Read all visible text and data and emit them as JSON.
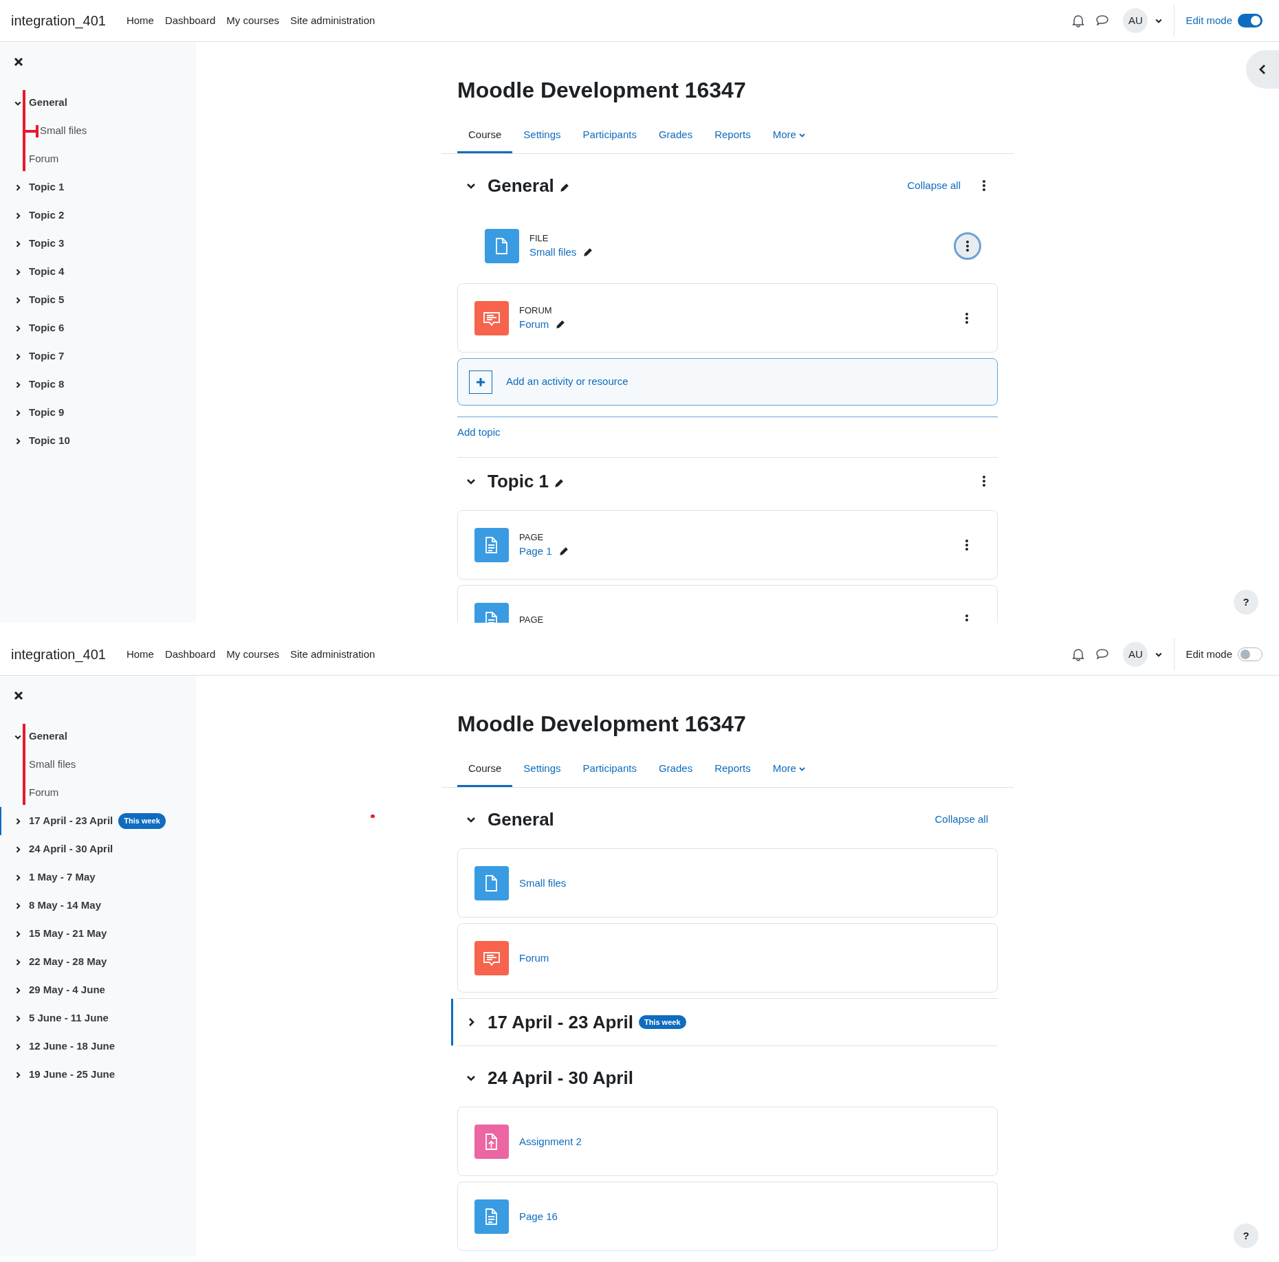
{
  "panels": [
    {
      "site_name": "integration_401",
      "nav": [
        "Home",
        "Dashboard",
        "My courses",
        "Site administration"
      ],
      "avatar": "AU",
      "edit_mode_label": "Edit mode",
      "edit_mode": true,
      "right_drawer_button": true,
      "annotation_dot": false,
      "help_label": "?",
      "sidebar": {
        "sections": [
          {
            "title": "General",
            "expanded": true,
            "annotated": true,
            "children": [
              {
                "title": "Small files",
                "annotated": true
              },
              {
                "title": "Forum"
              }
            ]
          },
          {
            "title": "Topic 1",
            "expanded": false
          },
          {
            "title": "Topic 2",
            "expanded": false
          },
          {
            "title": "Topic 3",
            "expanded": false
          },
          {
            "title": "Topic 4",
            "expanded": false
          },
          {
            "title": "Topic 5",
            "expanded": false
          },
          {
            "title": "Topic 6",
            "expanded": false
          },
          {
            "title": "Topic 7",
            "expanded": false
          },
          {
            "title": "Topic 8",
            "expanded": false
          },
          {
            "title": "Topic 9",
            "expanded": false
          },
          {
            "title": "Topic 10",
            "expanded": false
          }
        ]
      },
      "course_title": "Moodle Development 16347",
      "tabs": [
        {
          "label": "Course",
          "selected": true,
          "dropdown": false
        },
        {
          "label": "Settings",
          "selected": false,
          "dropdown": false
        },
        {
          "label": "Participants",
          "selected": false,
          "dropdown": false
        },
        {
          "label": "Grades",
          "selected": false,
          "dropdown": false
        },
        {
          "label": "Reports",
          "selected": false,
          "dropdown": false
        },
        {
          "label": "More",
          "selected": false,
          "dropdown": true
        }
      ],
      "sections": [
        {
          "title": "General",
          "expanded": true,
          "collapse_all": "Collapse all",
          "activities": [
            {
              "kind": "file",
              "type_label": "FILE",
              "name": "Small files",
              "boxed": false,
              "menu_focused": true
            },
            {
              "kind": "forum",
              "type_label": "FORUM",
              "name": "Forum",
              "boxed": true,
              "menu_focused": false
            }
          ],
          "add_activity": "Add an activity or resource",
          "add_topic": "Add topic"
        },
        {
          "title": "Topic 1",
          "expanded": true,
          "activities": [
            {
              "kind": "page",
              "type_label": "PAGE",
              "name": "Page 1",
              "boxed": true,
              "menu_focused": false
            },
            {
              "kind": "page",
              "type_label": "PAGE",
              "boxed": true,
              "menu_focused": false
            }
          ]
        }
      ]
    },
    {
      "site_name": "integration_401",
      "nav": [
        "Home",
        "Dashboard",
        "My courses",
        "Site administration"
      ],
      "avatar": "AU",
      "edit_mode_label": "Edit mode",
      "edit_mode": false,
      "right_drawer_button": false,
      "annotation_dot": true,
      "help_label": "?",
      "sidebar": {
        "sections": [
          {
            "title": "General",
            "expanded": true,
            "annotated": true,
            "children": [
              {
                "title": "Small files"
              },
              {
                "title": "Forum"
              }
            ]
          },
          {
            "title": "17 April - 23 April",
            "expanded": false,
            "current": true,
            "badge": "This week"
          },
          {
            "title": "24 April - 30 April",
            "expanded": false
          },
          {
            "title": "1 May - 7 May",
            "expanded": false
          },
          {
            "title": "8 May - 14 May",
            "expanded": false
          },
          {
            "title": "15 May - 21 May",
            "expanded": false
          },
          {
            "title": "22 May - 28 May",
            "expanded": false
          },
          {
            "title": "29 May - 4 June",
            "expanded": false
          },
          {
            "title": "5 June - 11 June",
            "expanded": false
          },
          {
            "title": "12 June - 18 June",
            "expanded": false
          },
          {
            "title": "19 June - 25 June",
            "expanded": false
          }
        ]
      },
      "course_title": "Moodle Development 16347",
      "tabs": [
        {
          "label": "Course",
          "selected": true,
          "dropdown": false
        },
        {
          "label": "Settings",
          "selected": false,
          "dropdown": false
        },
        {
          "label": "Participants",
          "selected": false,
          "dropdown": false
        },
        {
          "label": "Grades",
          "selected": false,
          "dropdown": false
        },
        {
          "label": "Reports",
          "selected": false,
          "dropdown": false
        },
        {
          "label": "More",
          "selected": false,
          "dropdown": true
        }
      ],
      "sections": [
        {
          "title": "General",
          "expanded": true,
          "collapse_all": "Collapse all",
          "activities": [
            {
              "kind": "file",
              "name": "Small files",
              "boxed": true
            },
            {
              "kind": "forum",
              "name": "Forum",
              "boxed": true
            }
          ]
        },
        {
          "title": "17 April - 23 April",
          "expanded": false,
          "current": true,
          "badge": "This week"
        },
        {
          "title": "24 April - 30 April",
          "expanded": true,
          "activities": [
            {
              "kind": "assign",
              "name": "Assignment 2",
              "boxed": true
            },
            {
              "kind": "page",
              "name": "Page 16",
              "boxed": true
            }
          ]
        }
      ]
    }
  ]
}
